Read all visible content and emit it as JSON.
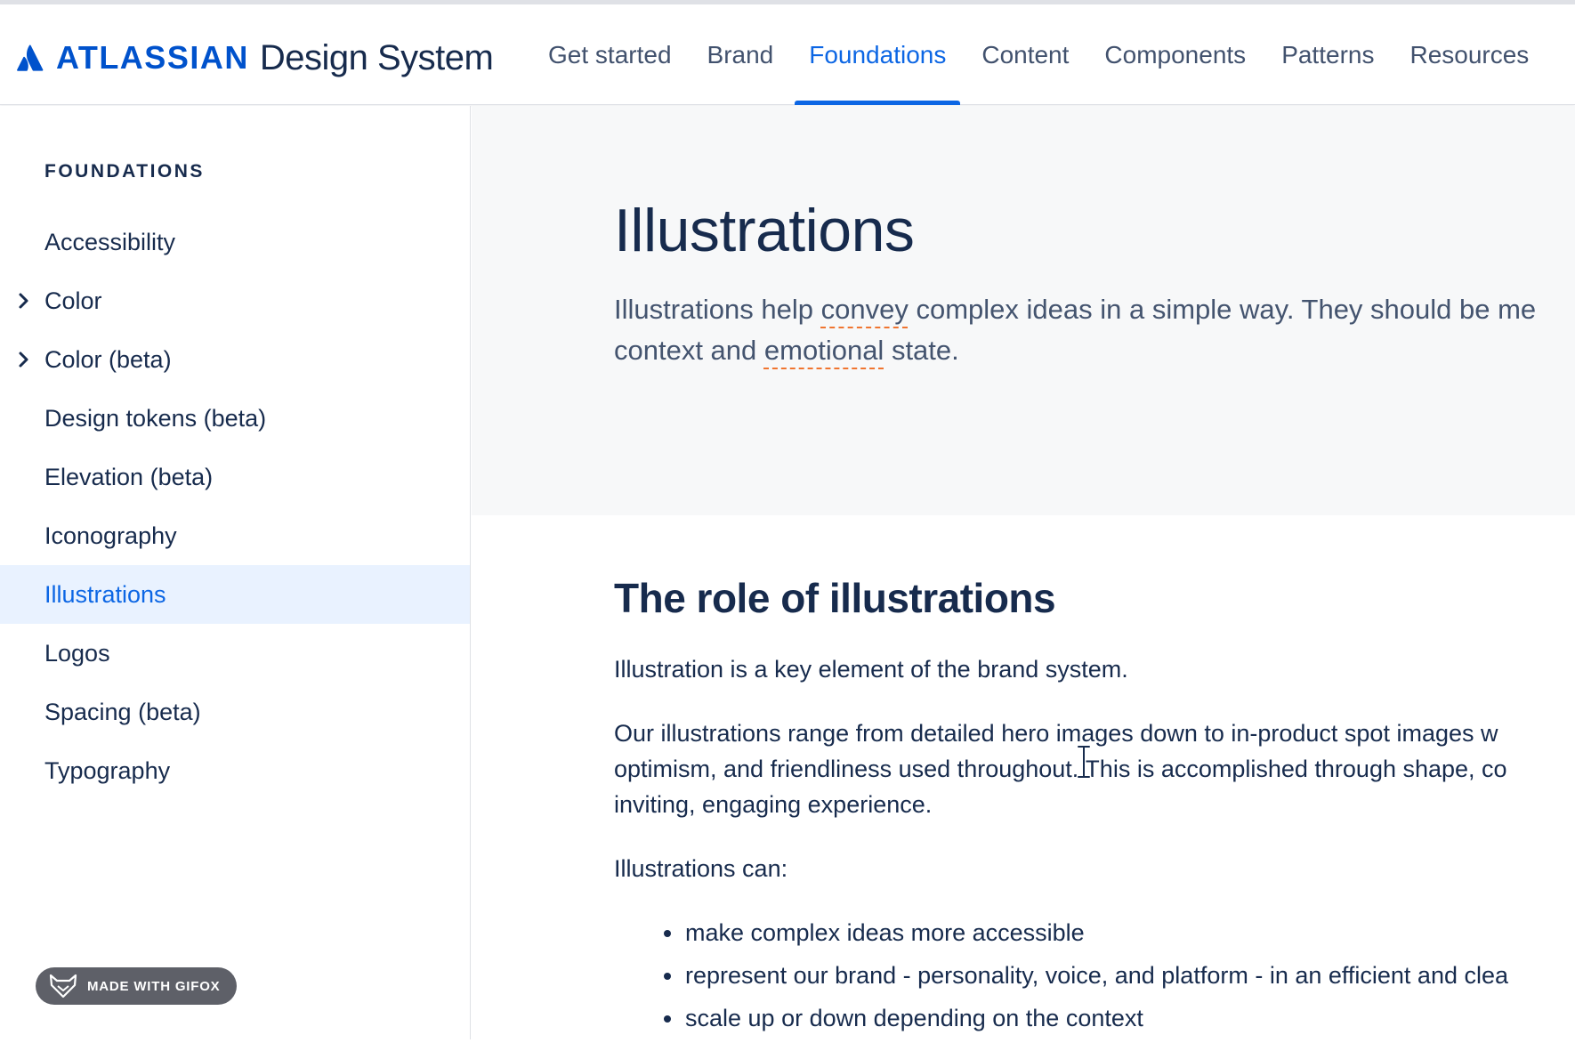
{
  "header": {
    "logo_word": "ATLASSIAN",
    "logo_product": "Design System",
    "nav": [
      {
        "label": "Get started",
        "active": false
      },
      {
        "label": "Brand",
        "active": false
      },
      {
        "label": "Foundations",
        "active": true
      },
      {
        "label": "Content",
        "active": false
      },
      {
        "label": "Components",
        "active": false
      },
      {
        "label": "Patterns",
        "active": false
      },
      {
        "label": "Resources",
        "active": false
      }
    ]
  },
  "sidebar": {
    "heading": "FOUNDATIONS",
    "items": [
      {
        "label": "Accessibility",
        "expandable": false,
        "selected": false
      },
      {
        "label": "Color",
        "expandable": true,
        "selected": false
      },
      {
        "label": "Color (beta)",
        "expandable": true,
        "selected": false
      },
      {
        "label": "Design tokens (beta)",
        "expandable": false,
        "selected": false
      },
      {
        "label": "Elevation (beta)",
        "expandable": false,
        "selected": false
      },
      {
        "label": "Iconography",
        "expandable": false,
        "selected": false
      },
      {
        "label": "Illustrations",
        "expandable": false,
        "selected": true
      },
      {
        "label": "Logos",
        "expandable": false,
        "selected": false
      },
      {
        "label": "Spacing (beta)",
        "expandable": false,
        "selected": false
      },
      {
        "label": "Typography",
        "expandable": false,
        "selected": false
      }
    ],
    "badge": "MADE WITH GIFOX"
  },
  "main": {
    "title": "Illustrations",
    "lead": {
      "line1_a": "Illustrations help ",
      "line1_b": "convey",
      "line1_c": " complex ideas in a simple way. They should be me",
      "line2_a": "context and ",
      "line2_b": "emotional",
      "line2_c": " state."
    },
    "section_title": "The role of illustrations",
    "para1": "Illustration is a key element of the brand system.",
    "para2_lines": [
      "Our illustrations range from detailed hero images down to in-product spot images w",
      "optimism, and friendliness used throughout. This is accomplished through shape, co",
      "inviting, engaging experience."
    ],
    "para3": "Illustrations can:",
    "bullets": [
      "make complex ideas more accessible",
      "represent our brand - personality, voice, and platform - in an efficient and clea",
      "scale up or down depending on the context"
    ]
  },
  "icons": {
    "logo": "atlassian-logo-icon",
    "chevron": "chevron-right-icon",
    "gifox": "fox-icon",
    "cursor": "text-cursor-icon"
  },
  "colors": {
    "brand_blue": "#0052cc",
    "link_blue": "#0c66e4",
    "selected_bg": "#e9f2ff",
    "hero_bg": "#f7f8f9",
    "text": "#172b4d",
    "subtle_text": "#44546f",
    "spell_underline": "#f07530"
  }
}
